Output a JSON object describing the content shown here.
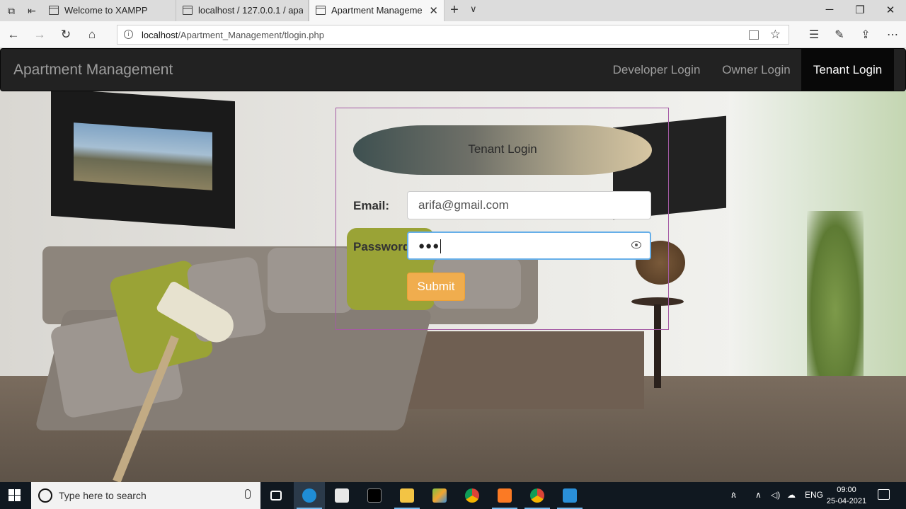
{
  "browser": {
    "tabs": [
      {
        "title": "Welcome to XAMPP"
      },
      {
        "title": "localhost / 127.0.0.1 / apartr"
      },
      {
        "title": "Apartment Managemer"
      }
    ],
    "url_host": "localhost",
    "url_path": "/Apartment_Management/tlogin.php"
  },
  "navbar": {
    "brand": "Apartment Management",
    "links": [
      "Developer Login",
      "Owner Login",
      "Tenant Login"
    ],
    "active": "Tenant Login"
  },
  "login": {
    "heading": "Tenant Login",
    "email_label": "Email:",
    "email_value": "arifa@gmail.com",
    "password_label": "Password",
    "password_value": "●●●",
    "submit_label": "Submit"
  },
  "taskbar": {
    "search_placeholder": "Type here to search",
    "language": "ENG",
    "time": "09:00",
    "date": "25-04-2021"
  },
  "colors": {
    "navbar_bg": "#222222",
    "submit_bg": "#f0ad4e",
    "login_border": "#a45aa4",
    "focus_border": "#66afe9"
  }
}
